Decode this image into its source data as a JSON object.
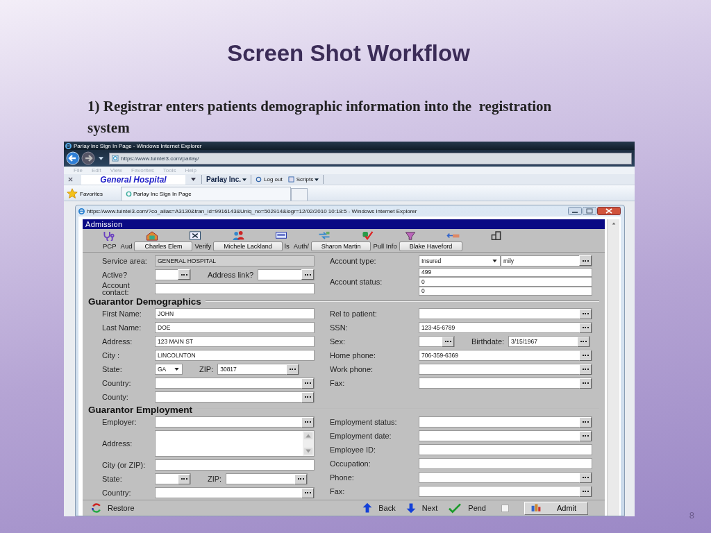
{
  "slide": {
    "title": "Screen Shot Workflow",
    "caption": "1) Registrar enters patients demographic information into the  registration system",
    "page_number": "8"
  },
  "browser": {
    "title": "Parlay Inc Sign In Page - Windows Internet Explorer",
    "address": "https://www.tuintel3.com/parlay/",
    "menu": [
      "File",
      "Edit",
      "View",
      "Favorites",
      "Tools",
      "Help"
    ],
    "toolbar": {
      "site": "General Hospital",
      "company": "Parlay Inc.",
      "logout": "Log out",
      "scripts": "Scripts"
    },
    "favorites": "Favorites",
    "tab": "Parlay Inc Sign In Page"
  },
  "popup": {
    "title": "https://www.tuintel3.com/?co_alias=A3130&tran_id=9916143&Uniq_no=502914&logr=12/02/2010 10:18:5 - Windows Internet Explorer"
  },
  "app": {
    "header": "Admission",
    "toolbar": [
      {
        "kind": "tool",
        "label": "PCP"
      },
      {
        "kind": "tool",
        "label": "Aud"
      },
      {
        "kind": "chip",
        "label": "Charles Elem"
      },
      {
        "kind": "tool",
        "label": "Verify"
      },
      {
        "kind": "chip",
        "label": "Michele Lackland"
      },
      {
        "kind": "tool",
        "label": "ls"
      },
      {
        "kind": "tool",
        "label": "Auth/"
      },
      {
        "kind": "chip",
        "label": "Sharon Martin"
      },
      {
        "kind": "tool",
        "label": "Pull Info"
      },
      {
        "kind": "chip",
        "label": "Blake Haveford"
      }
    ],
    "sections": [
      {
        "left": [
          [
            {
              "kind": "label",
              "text": "Service area:"
            },
            {
              "kind": "readonly",
              "value": "GENERAL HOSPITAL"
            }
          ],
          [
            {
              "kind": "label",
              "text": "Active?"
            },
            {
              "kind": "lookup"
            },
            {
              "kind": "label",
              "text": "Address link?"
            },
            {
              "kind": "lookup"
            }
          ],
          [
            {
              "kind": "label",
              "text": "Account contact:"
            },
            {
              "kind": "text"
            }
          ]
        ],
        "right": [
          [
            {
              "kind": "label",
              "text": "Account type:"
            },
            {
              "kind": "select",
              "value": "Insured"
            },
            {
              "kind": "lookup",
              "value": "mily"
            }
          ],
          [
            {
              "kind": "label",
              "text": "Account status:"
            },
            {
              "kind": "stack",
              "values": [
                "499",
                "0",
                "0"
              ]
            }
          ]
        ]
      },
      {
        "title": "Guarantor Demographics",
        "left": [
          [
            {
              "kind": "label",
              "text": "First Name:"
            },
            {
              "kind": "text",
              "value": "JOHN"
            }
          ],
          [
            {
              "kind": "label",
              "text": "Last Name:"
            },
            {
              "kind": "text",
              "value": "DOE"
            }
          ],
          [
            {
              "kind": "label",
              "text": "Address:"
            },
            {
              "kind": "text",
              "value": "123 MAIN ST"
            }
          ],
          [
            {
              "kind": "label",
              "text": "City :"
            },
            {
              "kind": "text",
              "value": "LINCOLNTON"
            }
          ],
          [
            {
              "kind": "label",
              "text": "State:"
            },
            {
              "kind": "select",
              "value": "GA"
            },
            {
              "kind": "label",
              "text": "ZIP:"
            },
            {
              "kind": "lookup",
              "value": "30817"
            }
          ],
          [
            {
              "kind": "label",
              "text": "Country:"
            },
            {
              "kind": "lookup"
            }
          ],
          [
            {
              "kind": "label",
              "text": "County:"
            },
            {
              "kind": "lookup"
            }
          ]
        ],
        "right": [
          [
            {
              "kind": "label",
              "text": "Rel to patient:"
            },
            {
              "kind": "lookup"
            }
          ],
          [
            {
              "kind": "label",
              "text": "SSN:"
            },
            {
              "kind": "lookup",
              "value": "123-45-6789"
            }
          ],
          [
            {
              "kind": "label",
              "text": "Sex:"
            },
            {
              "kind": "lookup"
            },
            {
              "kind": "label",
              "text": "Birthdate:"
            },
            {
              "kind": "lookup",
              "value": "3/15/1967"
            }
          ],
          [
            {
              "kind": "label",
              "text": "Home phone:"
            },
            {
              "kind": "lookup",
              "value": "706-359-6369"
            }
          ],
          [
            {
              "kind": "label",
              "text": "Work phone:"
            },
            {
              "kind": "lookup"
            }
          ],
          [
            {
              "kind": "label",
              "text": "Fax:"
            },
            {
              "kind": "lookup"
            }
          ]
        ]
      },
      {
        "title": "Guarantor Employment",
        "left": [
          [
            {
              "kind": "label",
              "text": "Employer:"
            },
            {
              "kind": "lookup"
            }
          ],
          [
            {
              "kind": "label",
              "text": "Address:"
            },
            {
              "kind": "memo"
            }
          ],
          [
            {
              "kind": "label",
              "text": "City (or ZIP):"
            },
            {
              "kind": "text"
            }
          ],
          [
            {
              "kind": "label",
              "text": "State:"
            },
            {
              "kind": "lookup"
            },
            {
              "kind": "label",
              "text": "ZIP:"
            },
            {
              "kind": "lookup"
            }
          ],
          [
            {
              "kind": "label",
              "text": "Country:"
            },
            {
              "kind": "lookup"
            }
          ]
        ],
        "right": [
          [
            {
              "kind": "label",
              "text": "Employment status:"
            },
            {
              "kind": "lookup"
            }
          ],
          [
            {
              "kind": "label",
              "text": "Employment date:"
            },
            {
              "kind": "lookup"
            }
          ],
          [
            {
              "kind": "label",
              "text": "Employee ID:"
            },
            {
              "kind": "text"
            }
          ],
          [
            {
              "kind": "label",
              "text": "Occupation:"
            },
            {
              "kind": "text"
            }
          ],
          [
            {
              "kind": "label",
              "text": "Phone:"
            },
            {
              "kind": "lookup"
            }
          ],
          [
            {
              "kind": "label",
              "text": "Fax:"
            },
            {
              "kind": "lookup"
            }
          ]
        ]
      }
    ],
    "bottom_bar": {
      "items": [
        {
          "kind": "restore",
          "label": "Restore"
        },
        {
          "kind": "back",
          "label": "Back"
        },
        {
          "kind": "next",
          "label": "Next"
        },
        {
          "kind": "pend",
          "label": "Pend"
        },
        {
          "kind": "checkbox",
          "checked": false
        },
        {
          "kind": "admit",
          "label": "Admit"
        }
      ]
    }
  }
}
